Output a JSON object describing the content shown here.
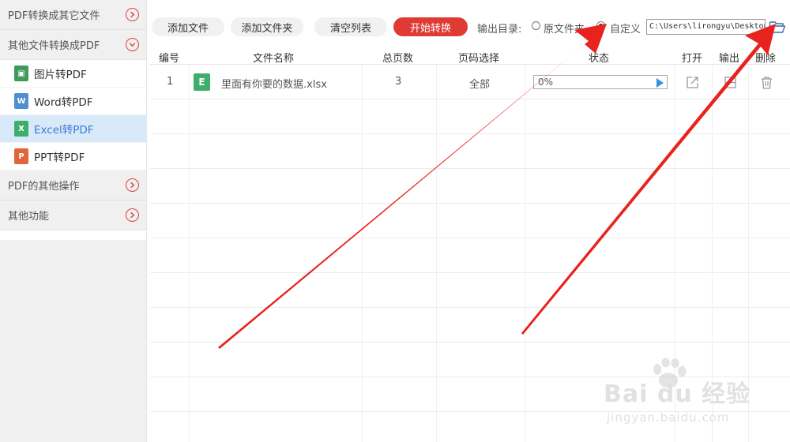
{
  "sidebar": {
    "sections": [
      {
        "label": "PDF转换成其它文件"
      },
      {
        "label": "其他文件转换成PDF"
      },
      {
        "label": "PDF的其他操作"
      },
      {
        "label": "其他功能"
      }
    ],
    "items": [
      {
        "label": "图片转PDF",
        "icon": "image-file-icon",
        "glyph": "▣",
        "color": "#3e9b5a"
      },
      {
        "label": "Word转PDF",
        "icon": "word-file-icon",
        "glyph": "W",
        "color": "#4f8fd2"
      },
      {
        "label": "Excel转PDF",
        "icon": "excel-file-icon",
        "glyph": "X",
        "color": "#3fae6a",
        "active": true
      },
      {
        "label": "PPT转PDF",
        "icon": "ppt-file-icon",
        "glyph": "P",
        "color": "#e0663a"
      }
    ]
  },
  "toolbar": {
    "add_file": "添加文件",
    "add_folder": "添加文件夹",
    "clear_list": "清空列表",
    "start": "开始转换",
    "output_label": "输出目录:",
    "option_original": "原文件夹",
    "option_custom": "自定义",
    "selected_option": "自定义",
    "path": "C:\\Users\\lirongyu\\Desktop"
  },
  "table": {
    "headers": {
      "index": "编号",
      "name": "文件名称",
      "pages": "总页数",
      "page_select": "页码选择",
      "status": "状态",
      "open": "打开",
      "output": "输出",
      "delete": "删除"
    },
    "rows": [
      {
        "index": "1",
        "icon_glyph": "E",
        "name": "里面有你要的数据.xlsx",
        "pages": "3",
        "page_select": "全部",
        "progress": "0%"
      }
    ]
  },
  "watermark": {
    "text": "Bai du 经验",
    "sub": "jingyan.baidu.com"
  },
  "colors": {
    "accent_red": "#e03a34",
    "active_bg": "#d8e9fa",
    "active_text": "#3a7bd5",
    "arrow_red": "#e8231e"
  }
}
